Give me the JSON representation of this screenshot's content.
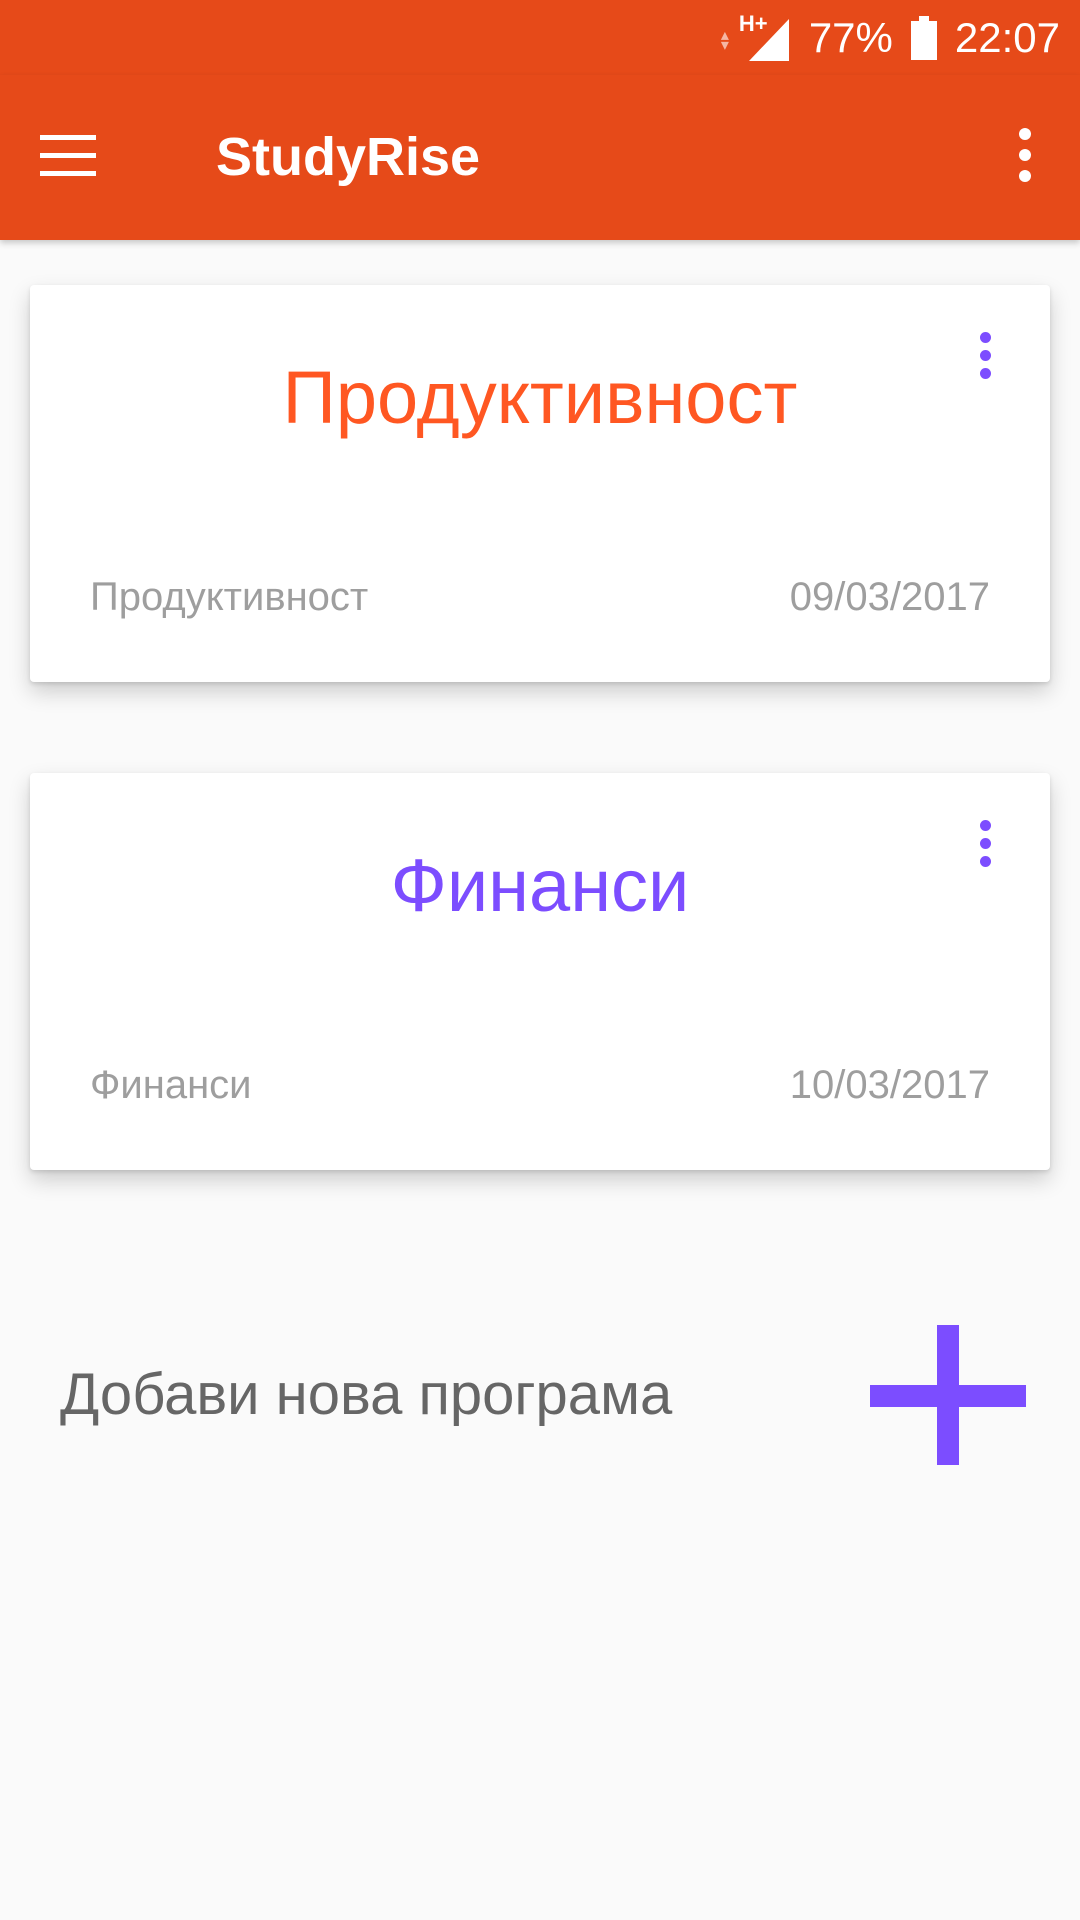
{
  "status_bar": {
    "network": "H+",
    "battery": "77%",
    "time": "22:07"
  },
  "app_bar": {
    "title": "StudyRise",
    "menu_icon": "hamburger-menu-icon",
    "overflow_icon": "more-vert-icon"
  },
  "programs": [
    {
      "title": "Продуктивност",
      "title_color": "#ff5722",
      "subtitle": "Продуктивност",
      "date": "09/03/2017"
    },
    {
      "title": "Финанси",
      "title_color": "#7c4dff",
      "subtitle": "Финанси",
      "date": "10/03/2017"
    }
  ],
  "add_program": {
    "label": "Добави нова програма",
    "icon": "plus-icon"
  },
  "colors": {
    "primary": "#e64a19",
    "accent": "#7c4dff",
    "background": "#fafafa"
  }
}
